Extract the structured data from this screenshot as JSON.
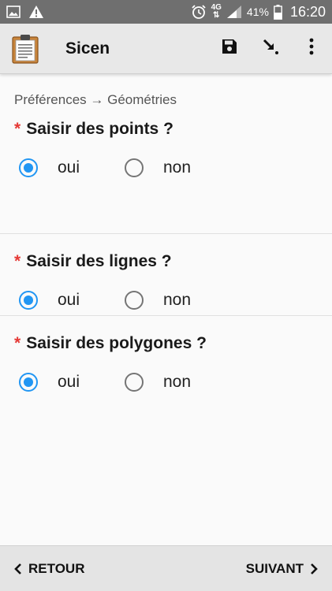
{
  "statusbar": {
    "left_icons": [
      "image-icon",
      "warning-icon"
    ],
    "network": "4G",
    "battery_percent": "41%",
    "time": "16:20"
  },
  "appbar": {
    "title": "Sicen",
    "icons": [
      "clipboard-icon",
      "save-icon",
      "download-arrow-icon",
      "more-vert-icon"
    ]
  },
  "breadcrumb": "Préférences → Géométries",
  "questions": [
    {
      "required_mark": "*",
      "label": "Saisir des points ?",
      "options": [
        "oui",
        "non"
      ],
      "selected": "oui"
    },
    {
      "required_mark": "*",
      "label": "Saisir des lignes ?",
      "options": [
        "oui",
        "non"
      ],
      "selected": "oui"
    },
    {
      "required_mark": "*",
      "label": "Saisir des polygones ?",
      "options": [
        "oui",
        "non"
      ],
      "selected": "oui"
    }
  ],
  "footer": {
    "back_label": "RETOUR",
    "next_label": "SUIVANT"
  },
  "colors": {
    "accent": "#2196f3",
    "required": "#e53935",
    "statusbar": "#6f6f6f",
    "appbar": "#e8e8e8"
  }
}
